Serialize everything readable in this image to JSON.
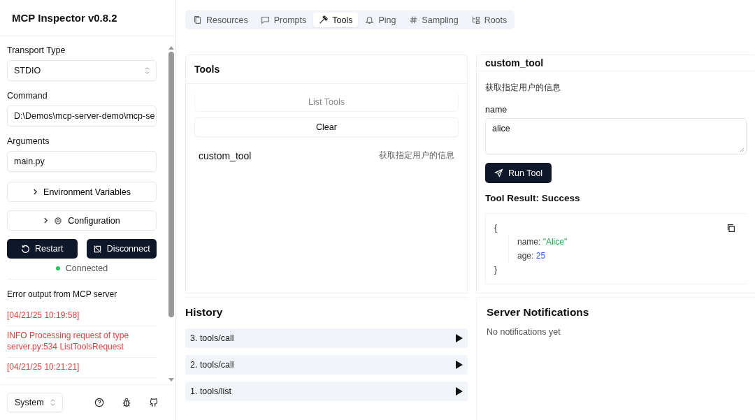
{
  "app": {
    "title": "MCP Inspector v0.8.2"
  },
  "sidebar": {
    "fields": [
      {
        "label": "Transport Type",
        "kind": "select",
        "value": "STDIO"
      },
      {
        "label": "Command",
        "kind": "text",
        "value": "D:\\Demos\\mcp-server-demo\\mcp-se"
      },
      {
        "label": "Arguments",
        "kind": "text",
        "value": "main.py"
      }
    ],
    "sections": [
      {
        "label": "Environment Variables",
        "kind": "plain",
        "expanded": false
      },
      {
        "label": "Configuration",
        "kind": "gear",
        "expanded": false
      }
    ],
    "buttons": [
      {
        "label": "Restart",
        "kind": "restart"
      },
      {
        "label": "Disconnect",
        "kind": "disconnect"
      }
    ],
    "status": {
      "label": "Connected",
      "color": "#22c55e"
    },
    "error_output": {
      "title": "Error output from MCP server",
      "lines": [
        "[04/21/25 10:19:58]",
        "INFO Processing request of type\nserver.py:534 ListToolsRequest",
        "[04/21/25 10:21:21]"
      ]
    },
    "footer": {
      "theme": "System"
    }
  },
  "tabs": [
    {
      "label": "Resources",
      "kind": "resources",
      "selected": false
    },
    {
      "label": "Prompts",
      "kind": "prompts",
      "selected": false
    },
    {
      "label": "Tools",
      "kind": "tools",
      "selected": true
    },
    {
      "label": "Ping",
      "kind": "ping",
      "selected": false
    },
    {
      "label": "Sampling",
      "kind": "sampling",
      "selected": false
    },
    {
      "label": "Roots",
      "kind": "roots",
      "selected": false
    }
  ],
  "tools_panel": {
    "title": "Tools",
    "buttons": [
      {
        "label": "List Tools",
        "disabled": true
      },
      {
        "label": "Clear",
        "disabled": false
      }
    ],
    "tools": [
      {
        "name": "custom_tool",
        "description": "获取指定用户的信息"
      }
    ]
  },
  "tool_detail": {
    "title": "custom_tool",
    "description": "获取指定用户的信息",
    "param_label": "name",
    "param_value": "alice",
    "run_button": "Run Tool",
    "result_title": "Tool Result: Success",
    "result": {
      "open": "{",
      "close": "}",
      "lines": [
        {
          "key": "name:",
          "value": "\"Alice\"",
          "kind": "string"
        },
        {
          "key": "age:",
          "value": "25",
          "kind": "number"
        }
      ]
    }
  },
  "history": {
    "title": "History",
    "items": [
      {
        "label": "3. tools/call"
      },
      {
        "label": "2. tools/call"
      },
      {
        "label": "1. tools/list"
      }
    ]
  },
  "notifications": {
    "title": "Server Notifications",
    "empty": "No notifications yet"
  }
}
